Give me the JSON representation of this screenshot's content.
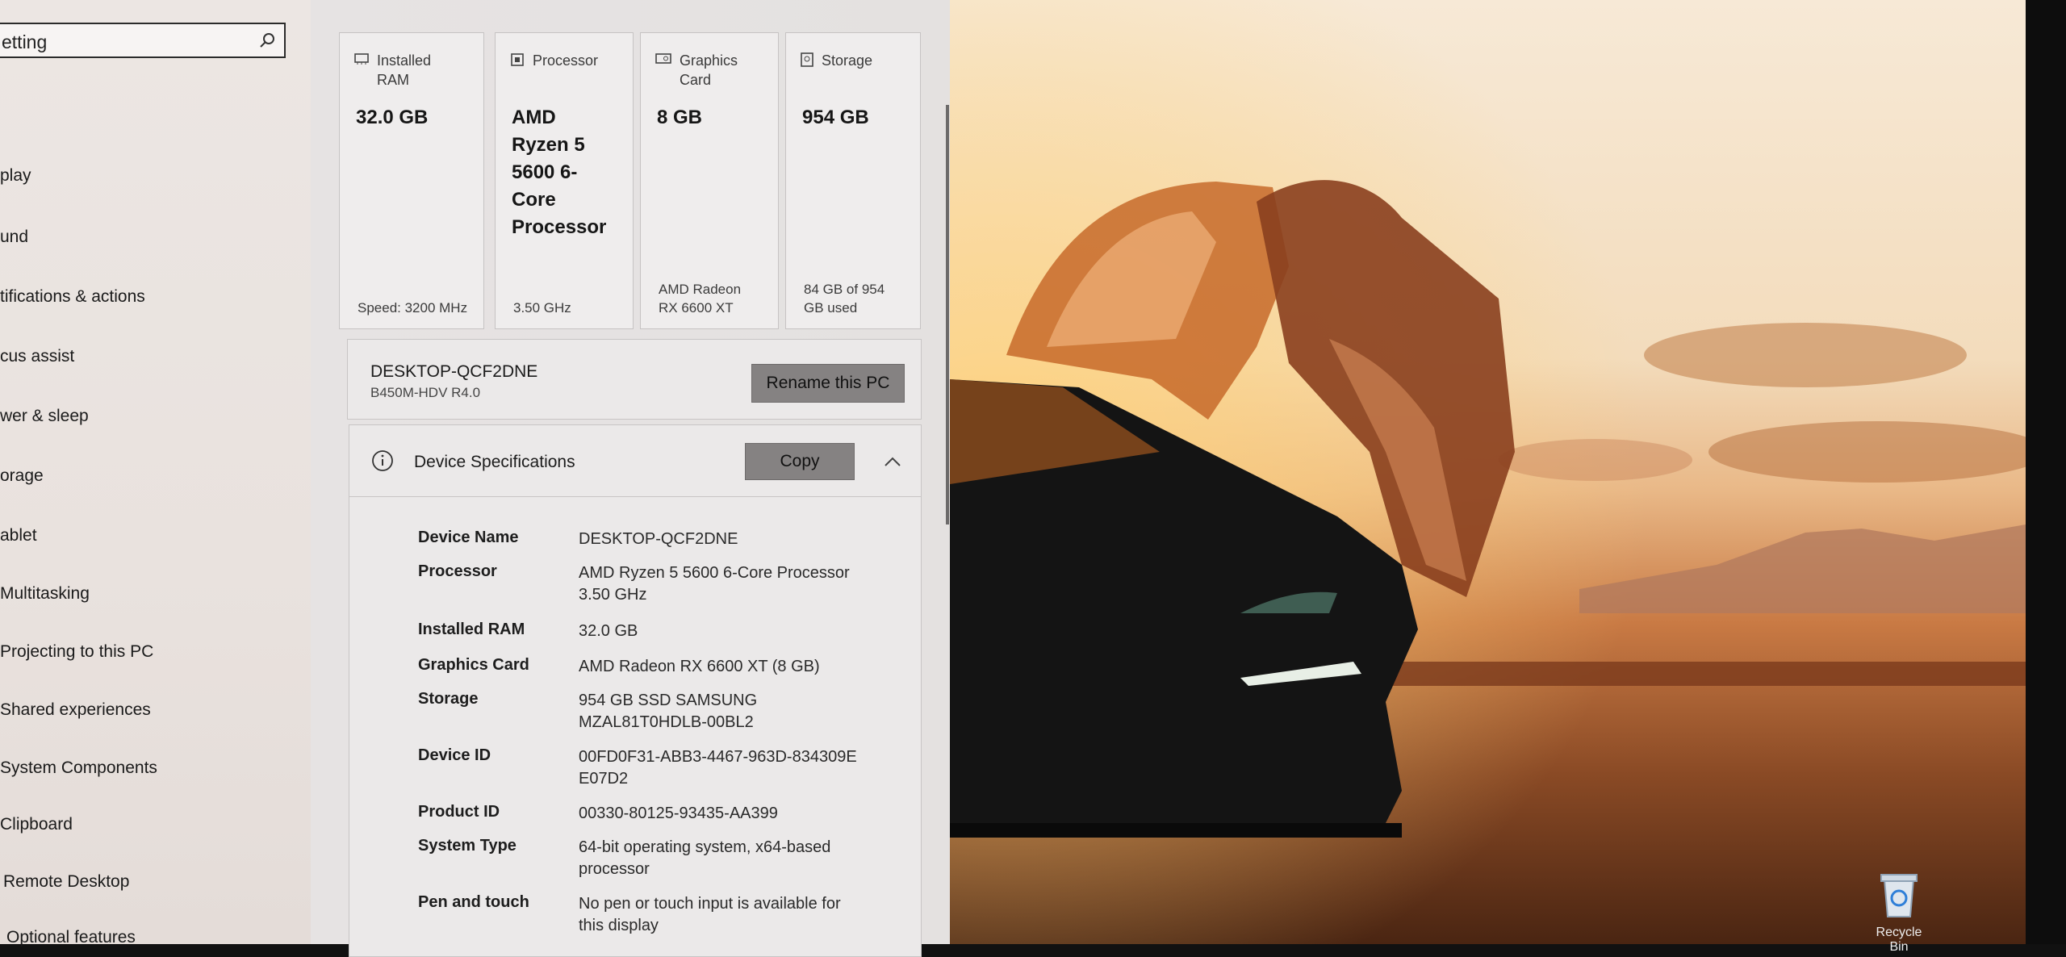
{
  "search": {
    "value": "etting"
  },
  "nav": {
    "items": [
      "play",
      "und",
      "tifications & actions",
      "cus assist",
      "wer & sleep",
      "orage",
      "ablet",
      "Multitasking",
      "Projecting to this PC",
      "Shared experiences",
      "System Components",
      "Clipboard",
      "Remote Desktop",
      "Optional features"
    ]
  },
  "cards": [
    {
      "title": "Installed RAM",
      "value": "32.0 GB",
      "sub": "Speed: 3200 MHz"
    },
    {
      "title": "Processor",
      "value": "AMD Ryzen 5 5600 6-Core Processor",
      "sub": "3.50 GHz"
    },
    {
      "title": "Graphics Card",
      "value": "8 GB",
      "sub": "AMD Radeon RX 6600 XT"
    },
    {
      "title": "Storage",
      "value": "954 GB",
      "sub": "84 GB of 954 GB used"
    }
  ],
  "pc": {
    "name": "DESKTOP-QCF2DNE",
    "model": "B450M-HDV R4.0",
    "rename_label": "Rename this PC"
  },
  "specs": {
    "title": "Device Specifications",
    "copy_label": "Copy",
    "rows": [
      {
        "k": "Device Name",
        "v": "DESKTOP-QCF2DNE"
      },
      {
        "k": "Processor",
        "v": "AMD Ryzen 5 5600 6-Core Processor 3.50 GHz"
      },
      {
        "k": "Installed RAM",
        "v": "32.0 GB"
      },
      {
        "k": "Graphics Card",
        "v": "AMD Radeon RX 6600 XT (8 GB)"
      },
      {
        "k": "Storage",
        "v": "954 GB SSD SAMSUNG MZAL81T0HDLB-00BL2"
      },
      {
        "k": "Device ID",
        "v": "00FD0F31-ABB3-4467-963D-834309EE07D2"
      },
      {
        "k": "Product ID",
        "v": "00330-80125-93435-AA399"
      },
      {
        "k": "System Type",
        "v": "64-bit operating system, x64-based processor"
      },
      {
        "k": "Pen and touch",
        "v": "No pen or touch input is available for this display"
      }
    ]
  },
  "desktop": {
    "recycle_label": "Recycle Bin"
  }
}
